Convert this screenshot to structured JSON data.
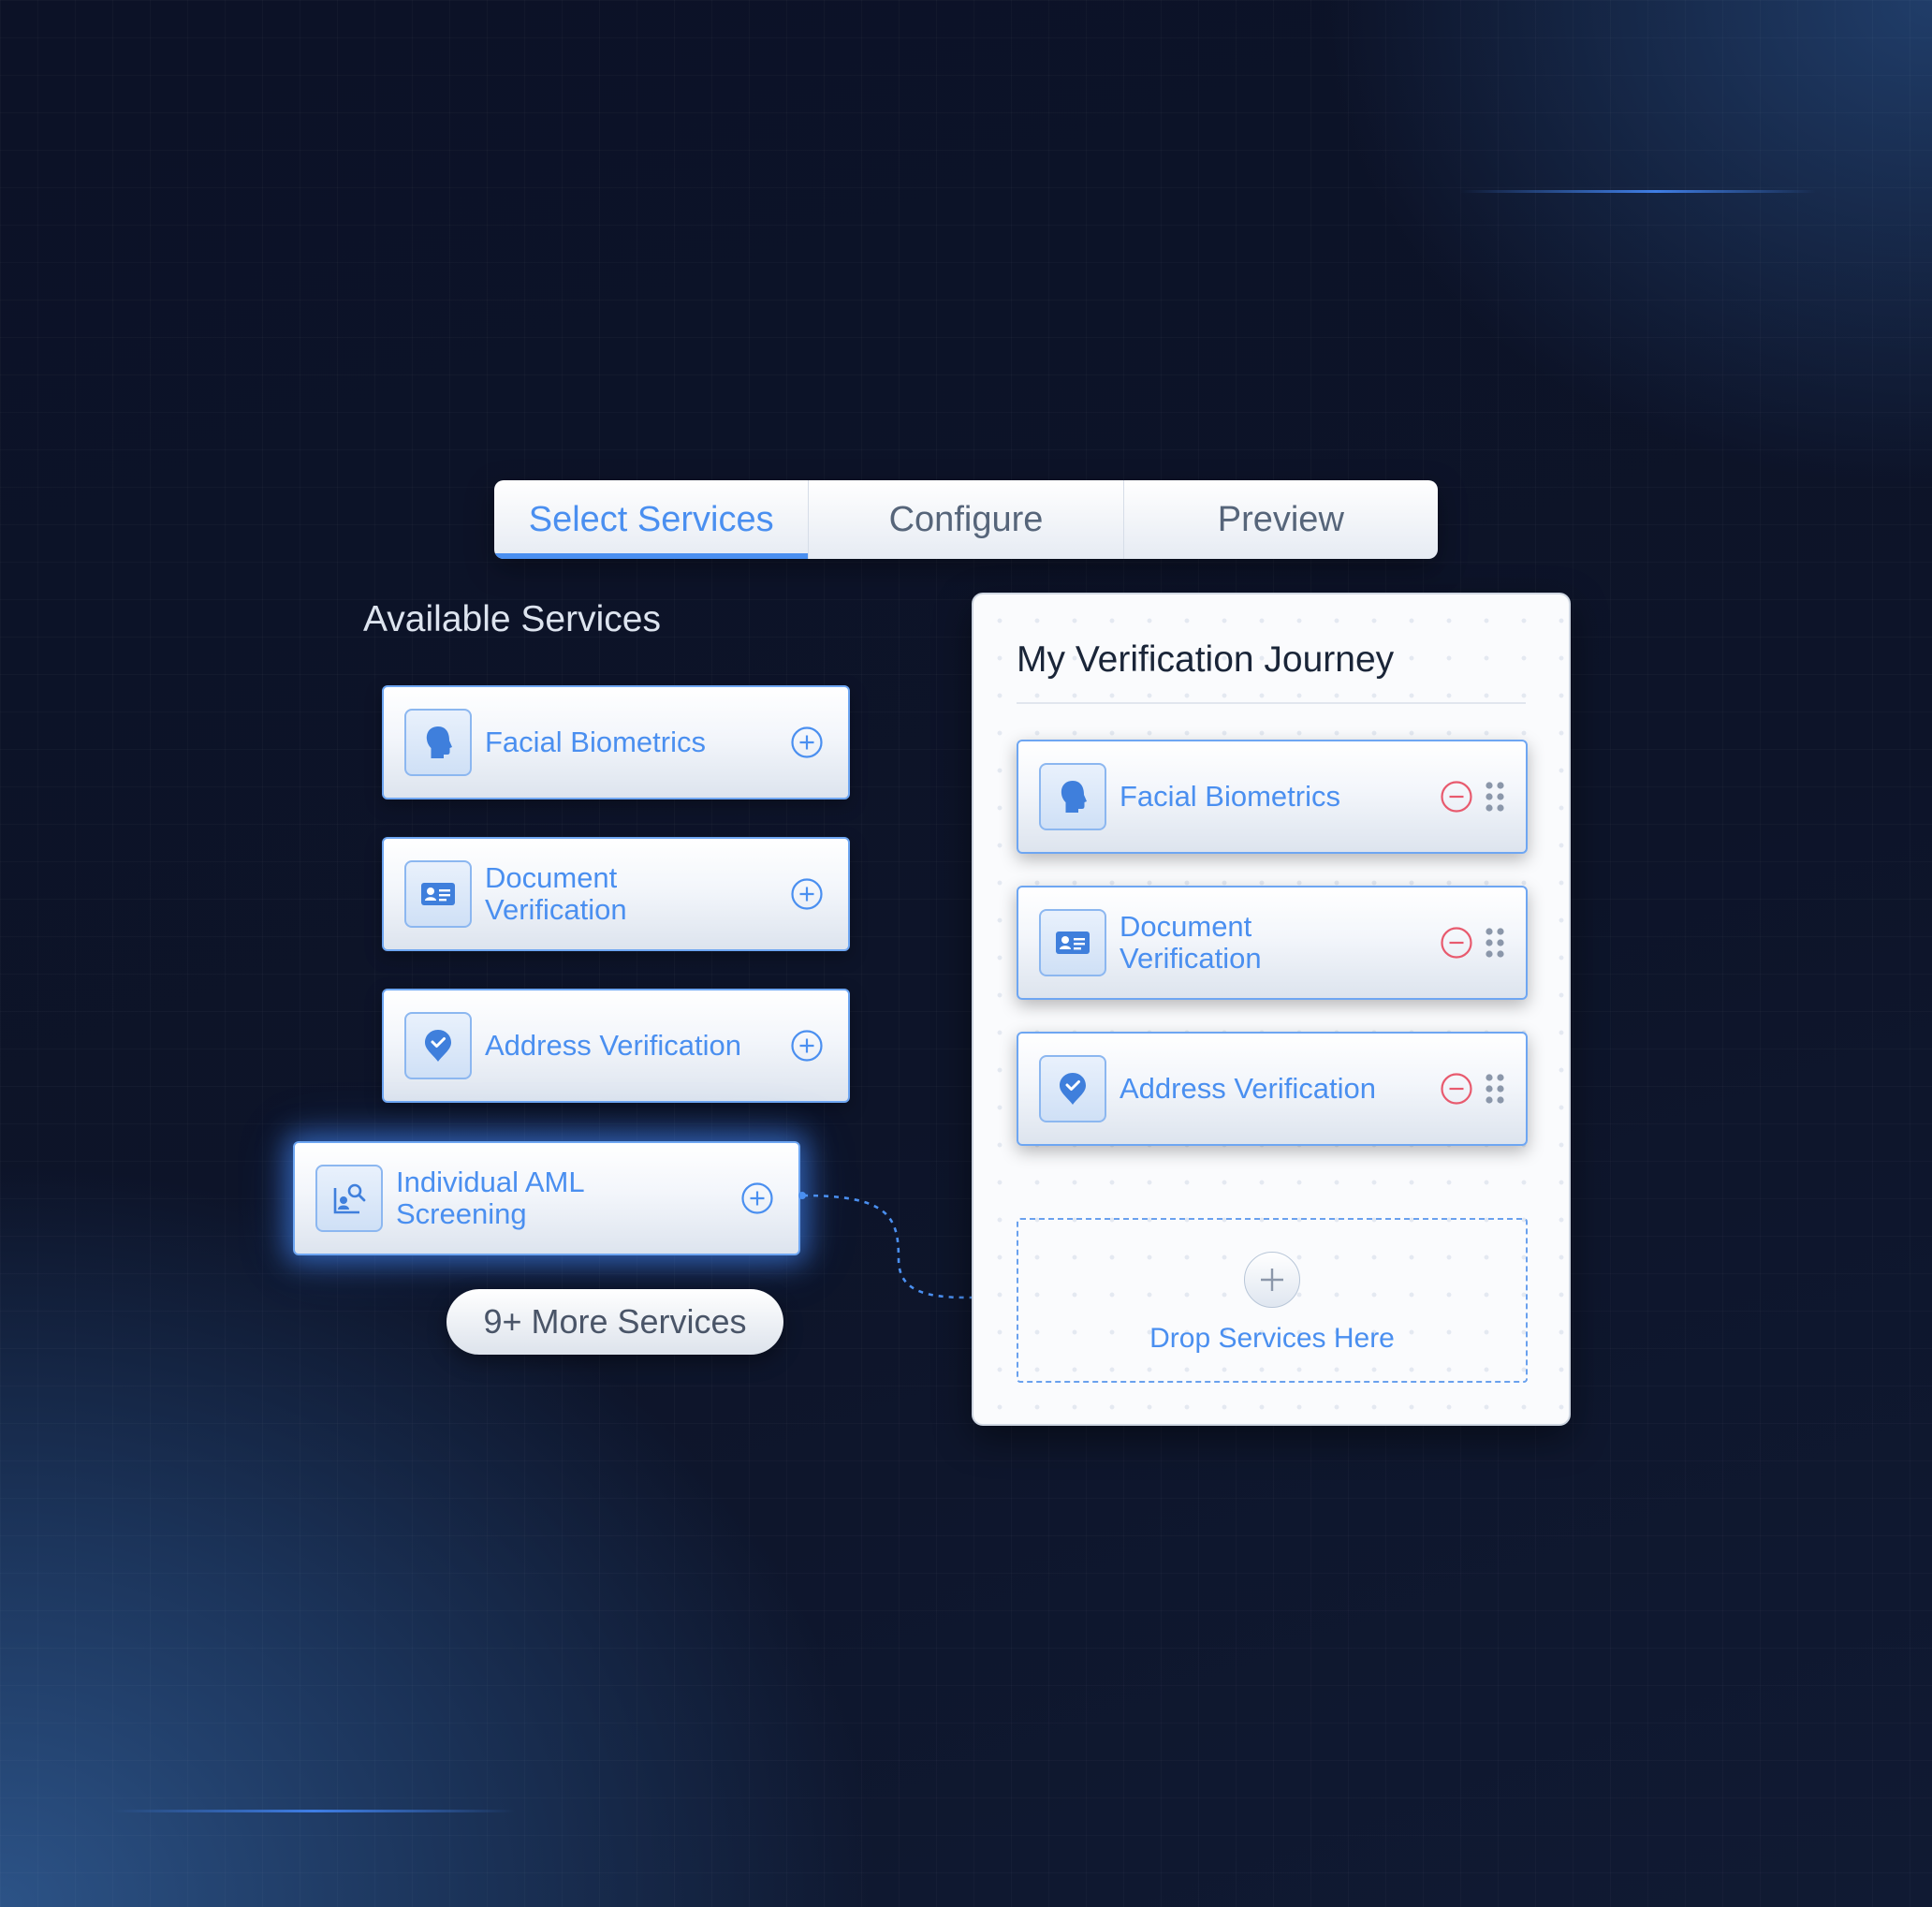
{
  "tabs": [
    {
      "label": "Select Services",
      "active": true
    },
    {
      "label": "Configure",
      "active": false
    },
    {
      "label": "Preview",
      "active": false
    }
  ],
  "available": {
    "title": "Available Services",
    "services": [
      {
        "label": "Facial Biometrics",
        "icon": "face-icon"
      },
      {
        "label": "Document\nVerification",
        "icon": "id-card-icon"
      },
      {
        "label": "Address Verification",
        "icon": "location-pin-icon"
      },
      {
        "label": "Individual AML\nScreening",
        "icon": "person-search-icon",
        "state": "dragging"
      }
    ],
    "more_label": "9+ More Services"
  },
  "journey": {
    "title": "My Verification Journey",
    "steps": [
      {
        "label": "Facial Biometrics",
        "icon": "face-icon"
      },
      {
        "label": "Document\nVerification",
        "icon": "id-card-icon"
      },
      {
        "label": "Address Verification",
        "icon": "location-pin-icon"
      }
    ],
    "drop_label": "Drop Services Here"
  },
  "colors": {
    "accent": "#4a8ff0",
    "remove": "#e85a6e",
    "background": "#0d1429"
  }
}
